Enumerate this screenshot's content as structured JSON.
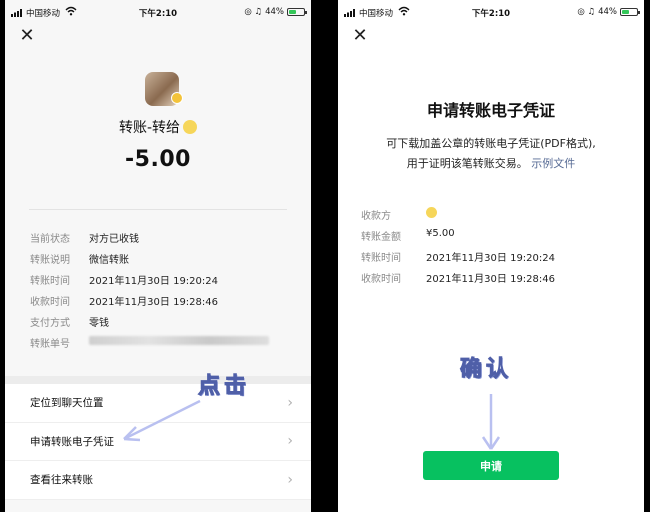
{
  "status": {
    "carrier": "中国移动",
    "time": "下午2:10",
    "battery": "44%"
  },
  "left": {
    "payee": "转账-转给",
    "amount": "-5.00",
    "details": [
      {
        "label": "当前状态",
        "value": "对方已收钱"
      },
      {
        "label": "转账说明",
        "value": "微信转账"
      },
      {
        "label": "转账时间",
        "value": "2021年11月30日 19:20:24"
      },
      {
        "label": "收款时间",
        "value": "2021年11月30日 19:28:46"
      },
      {
        "label": "支付方式",
        "value": "零钱"
      },
      {
        "label": "转账单号",
        "value": ""
      }
    ],
    "menu": [
      {
        "label": "定位到聊天位置"
      },
      {
        "label": "申请转账电子凭证"
      },
      {
        "label": "查看往来转账"
      }
    ],
    "annotation": "点击"
  },
  "right": {
    "title": "申请转账电子凭证",
    "desc_line1": "可下载加盖公章的转账电子凭证(PDF格式),",
    "desc_line2": "用于证明该笔转账交易。",
    "link": "示例文件",
    "details": [
      {
        "label": "收款方",
        "value": ""
      },
      {
        "label": "转账金额",
        "value": "¥5.00"
      },
      {
        "label": "转账时间",
        "value": "2021年11月30日 19:20:24"
      },
      {
        "label": "收款时间",
        "value": "2021年11月30日 19:28:46"
      }
    ],
    "button": "申请",
    "annotation": "确认"
  },
  "colors": {
    "accent_green": "#07c160",
    "link_blue": "#576b95",
    "annotation_stroke": "#4f5fa8"
  }
}
